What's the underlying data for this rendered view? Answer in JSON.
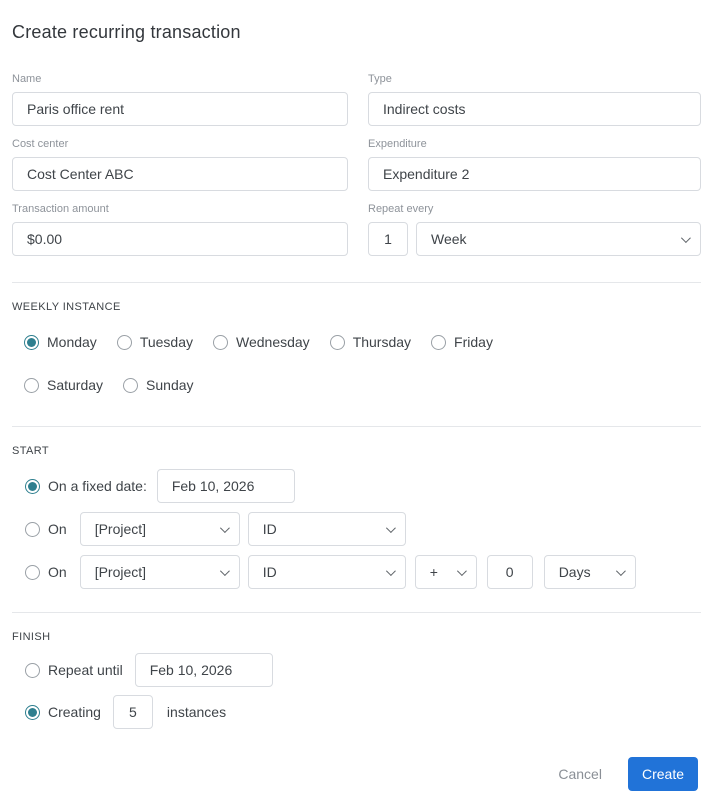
{
  "title": "Create recurring transaction",
  "fields": {
    "name": {
      "label": "Name",
      "value": "Paris office rent"
    },
    "type": {
      "label": "Type",
      "value": "Indirect costs"
    },
    "cost_center": {
      "label": "Cost center",
      "value": "Cost Center ABC"
    },
    "expenditure": {
      "label": "Expenditure",
      "value": "Expenditure 2"
    },
    "transaction_amount": {
      "label": "Transaction amount",
      "value": "$0.00"
    },
    "repeat_every": {
      "label": "Repeat every",
      "count": "1",
      "unit": "Week"
    }
  },
  "weekly_instance": {
    "heading": "WEEKLY INSTANCE",
    "days": [
      {
        "label": "Monday",
        "selected": true
      },
      {
        "label": "Tuesday",
        "selected": false
      },
      {
        "label": "Wednesday",
        "selected": false
      },
      {
        "label": "Thursday",
        "selected": false
      },
      {
        "label": "Friday",
        "selected": false
      },
      {
        "label": "Saturday",
        "selected": false
      },
      {
        "label": "Sunday",
        "selected": false
      }
    ]
  },
  "start": {
    "heading": "START",
    "fixed_date": {
      "label": "On a fixed date:",
      "value": "Feb 10, 2026",
      "selected": true
    },
    "on_event_row": {
      "label": "On",
      "project": "[Project]",
      "field": "ID",
      "selected": false
    },
    "on_event_offset_row": {
      "label": "On",
      "project": "[Project]",
      "field": "ID",
      "operator": "+",
      "offset": "0",
      "unit": "Days",
      "selected": false
    }
  },
  "finish": {
    "heading": "FINISH",
    "repeat_until": {
      "label": "Repeat until",
      "value": "Feb 10, 2026",
      "selected": false
    },
    "creating": {
      "label": "Creating",
      "value": "5",
      "suffix": "instances",
      "selected": true
    }
  },
  "footer": {
    "cancel": "Cancel",
    "create": "Create"
  },
  "colors": {
    "accent_teal": "#2e7f8f",
    "primary_blue": "#2173d8"
  }
}
